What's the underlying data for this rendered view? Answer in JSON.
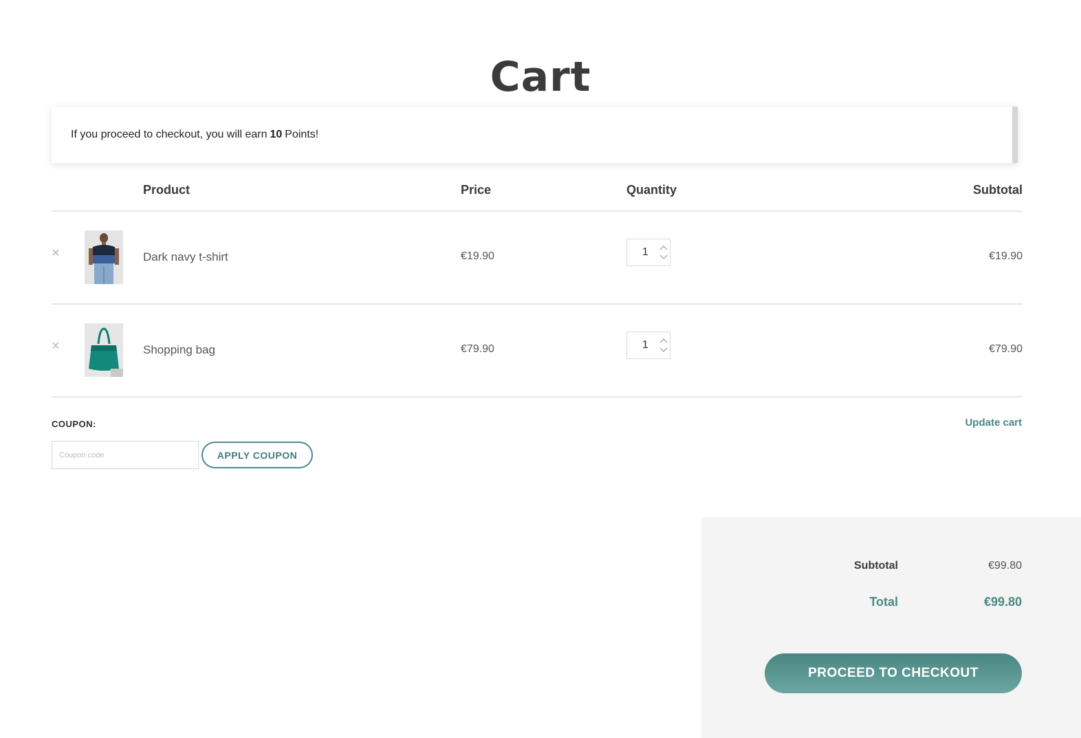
{
  "page": {
    "title": "Cart"
  },
  "notice": {
    "prefix": "If you proceed to checkout, you will earn",
    "points": "10",
    "suffix": "Points!"
  },
  "table": {
    "headers": {
      "product": "Product",
      "price": "Price",
      "quantity": "Quantity",
      "subtotal": "Subtotal"
    },
    "rows": [
      {
        "name": "Dark navy t-shirt",
        "price": "€19.90",
        "quantity": "1",
        "subtotal": "€19.90",
        "thumbnail_icon": "tshirt-model-image"
      },
      {
        "name": "Shopping bag",
        "price": "€79.90",
        "quantity": "1",
        "subtotal": "€79.90",
        "thumbnail_icon": "teal-bag-image"
      }
    ],
    "remove_symbol": "×"
  },
  "coupon": {
    "label": "COUPON:",
    "placeholder": "Coupon code",
    "value": "",
    "apply_label": "APPLY COUPON"
  },
  "update_cart_label": "Update cart",
  "totals": {
    "subtotal_label": "Subtotal",
    "subtotal_value": "€99.80",
    "total_label": "Total",
    "total_value": "€99.80",
    "checkout_label": "PROCEED TO CHECKOUT"
  },
  "colors": {
    "accent": "#4a8783",
    "totals_bg": "#f4f4f4",
    "divider": "#e6e6e6"
  }
}
